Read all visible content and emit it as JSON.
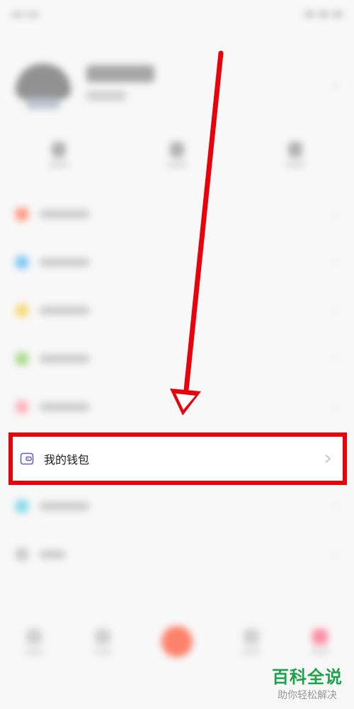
{
  "wallet_item": {
    "label": "我的钱包",
    "icon": "wallet-icon",
    "chevron": "chevron-right-icon"
  },
  "highlight": {
    "border_color": "#e8000b",
    "arrow_color": "#e8000b"
  },
  "watermark": {
    "title": "百科全说",
    "subtitle": "助你轻松解决",
    "color": "#1aa34a"
  },
  "blurred_menu_icons": [
    "#ff7a5a",
    "#59b7f5",
    "#f7d24e",
    "#8fd46a",
    "#ff9aa8",
    "#5fd0e8",
    "#bdbdbd"
  ]
}
